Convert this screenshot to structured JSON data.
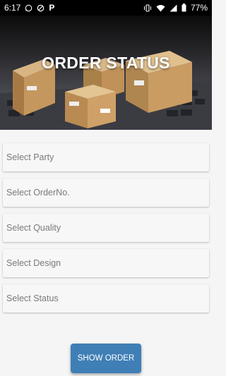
{
  "status_bar": {
    "time": "6:17",
    "battery": "77%",
    "left_icons": [
      "whatsapp-icon",
      "data-saver-icon",
      "p-app-icon"
    ],
    "right_icons": [
      "vibrate-icon",
      "wifi-icon",
      "signal-icon",
      "battery-icon"
    ]
  },
  "header": {
    "title": "ORDER STATUS"
  },
  "form": {
    "fields": [
      {
        "label": "Select Party"
      },
      {
        "label": "Select OrderNo."
      },
      {
        "label": "Select Quality"
      },
      {
        "label": "Select Design"
      },
      {
        "label": "Select Status"
      }
    ]
  },
  "actions": {
    "show_order_label": "SHOW ORDER"
  },
  "colors": {
    "button": "#3f7fb6",
    "background": "#f5f5f5",
    "status_bar": "#000000"
  }
}
